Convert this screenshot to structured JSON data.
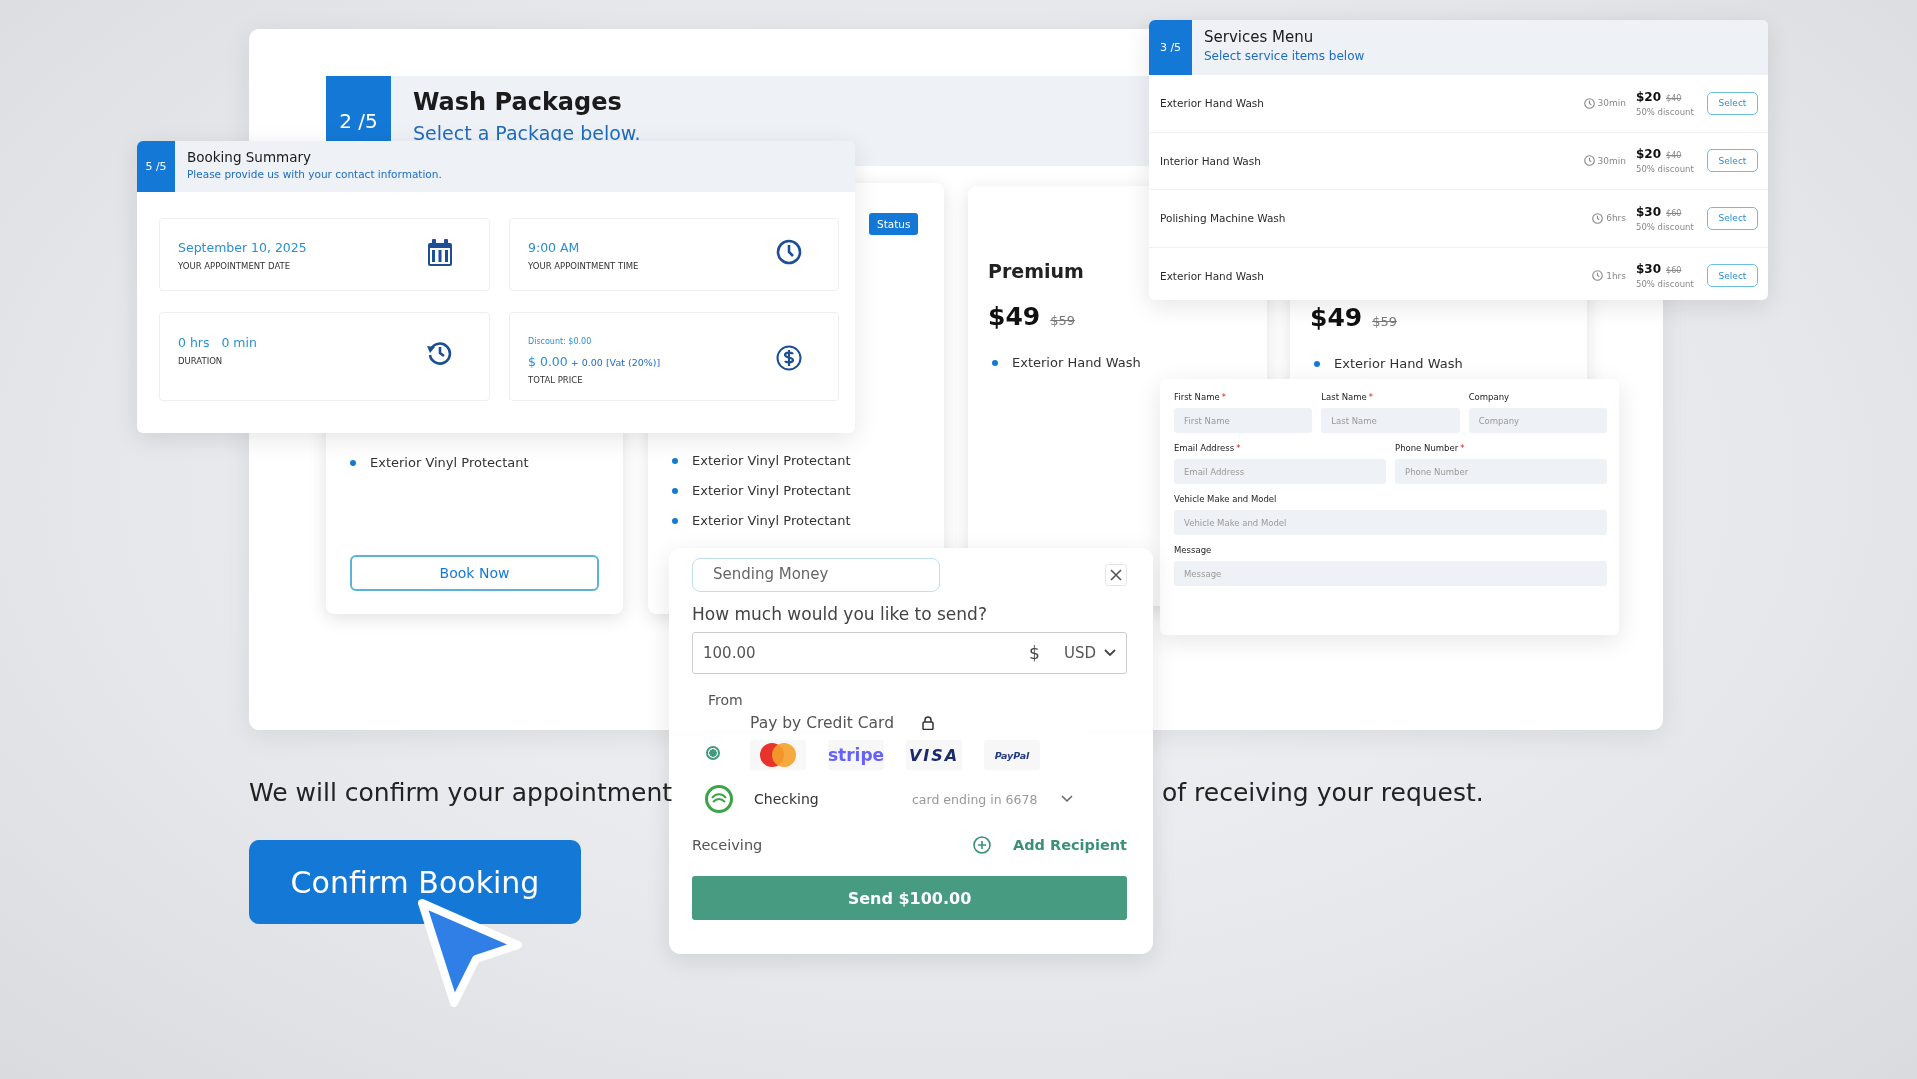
{
  "wash_packages": {
    "step": "2 /5",
    "title": "Wash Packages",
    "subtitle": "Select a Package below.",
    "cards": [
      {
        "features": [
          "Exterior Vinyl Protectant"
        ],
        "button": "Book Now"
      },
      {
        "badge": "Status",
        "features": [
          "Exterior Vinyl Protectant",
          "Exterior Vinyl Protectant",
          "Exterior Vinyl Protectant"
        ]
      },
      {
        "title": "Premium",
        "price": "$49",
        "old_price": "$59",
        "features": [
          "Exterior Hand Wash"
        ]
      },
      {
        "price": "$49",
        "old_price": "$59",
        "features": [
          "Exterior Hand Wash"
        ]
      }
    ]
  },
  "booking_summary": {
    "step": "5 /5",
    "title": "Booking Summary",
    "subtitle": "Please provide us with your contact information.",
    "tiles": [
      {
        "kind": "calendar",
        "value": "September 10, 2025",
        "label": "YOUR APPOINTMENT DATE"
      },
      {
        "kind": "clock",
        "value": "9:00 AM",
        "label": "YOUR APPOINTMENT TIME"
      },
      {
        "kind": "history",
        "value": "0 hrs   0 min",
        "label": "DURATION"
      },
      {
        "kind": "dollar",
        "note": "Discount: $0.00",
        "value": "$ 0.00",
        "extra": "+ 0.00 [Vat (20%)]",
        "label": "TOTAL PRICE"
      }
    ]
  },
  "services_menu": {
    "step": "3 /5",
    "title": "Services Menu",
    "subtitle": "Select service items below",
    "items": [
      {
        "name": "Exterior Hand Wash",
        "duration": "30min",
        "price": "$20",
        "old_price": "$40",
        "discount": "50% discount",
        "button": "Select"
      },
      {
        "name": "Interior Hand Wash",
        "duration": "30min",
        "price": "$20",
        "old_price": "$40",
        "discount": "50% discount",
        "button": "Select"
      },
      {
        "name": "Polishing Machine Wash",
        "duration": "6hrs",
        "price": "$30",
        "old_price": "$60",
        "discount": "50% discount",
        "button": "Select"
      },
      {
        "name": "Exterior Hand Wash",
        "duration": "1hrs",
        "price": "$30",
        "old_price": "$60",
        "discount": "50% discount",
        "button": "Select"
      }
    ]
  },
  "contact_form": {
    "rows": [
      [
        {
          "label": "First Name",
          "marker": "*",
          "placeholder": "First Name"
        },
        {
          "label": "Last Name",
          "marker": "*",
          "placeholder": "Last Name"
        },
        {
          "label": "Company",
          "placeholder": "Company"
        }
      ],
      [
        {
          "label": "Email Address",
          "marker": "*",
          "placeholder": "Email Address"
        },
        {
          "label": "Phone Number",
          "marker": "*",
          "placeholder": "Phone Number"
        }
      ],
      [
        {
          "label": "Vehicle Make and Model",
          "placeholder": "Vehicle Make and Model"
        }
      ],
      [
        {
          "label": "Message",
          "placeholder": "Message"
        }
      ]
    ]
  },
  "sending_money": {
    "title": "Sending Money",
    "question": "How much would you like to send?",
    "amount": "100.00",
    "currency_symbol": "$",
    "currency": "USD",
    "from_label": "From",
    "options": [
      {
        "label": "Pay by Credit Card",
        "selected": true
      }
    ],
    "methods": [
      {
        "kind": "mastercard"
      },
      {
        "kind": "stripe",
        "label": "stripe"
      },
      {
        "kind": "visa",
        "label": "VISA"
      },
      {
        "kind": "paypal",
        "label": "PayPal"
      }
    ],
    "account": {
      "name": "Checking",
      "detail": "card ending in 6678"
    },
    "receiving_label": "Receiving",
    "add_recipient": "Add Recipient",
    "send_button": "Send $100.00"
  },
  "confirmation": {
    "text_left": "We will confirm your appointment",
    "text_right": "of receiving your request."
  },
  "confirm_button": "Confirm Booking"
}
